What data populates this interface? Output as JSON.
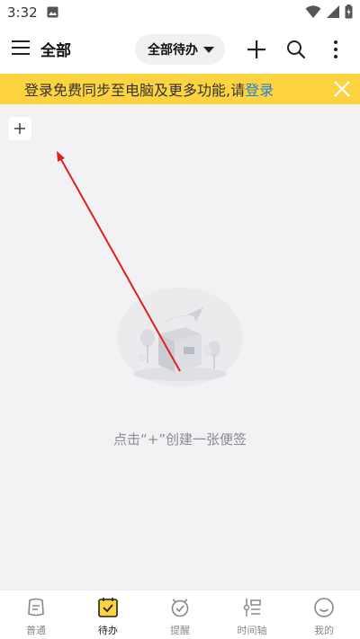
{
  "status": {
    "time": "3:32",
    "icons": [
      "image-icon",
      "wifi-icon",
      "signal-icon",
      "battery-icon"
    ]
  },
  "app_bar": {
    "title": "全部",
    "filter_label": "全部待办",
    "icons": [
      "menu-icon",
      "add-icon",
      "search-icon",
      "more-icon"
    ]
  },
  "banner": {
    "text": "登录免费同步至电脑及更多功能,请",
    "link": "登录",
    "color": "#fdd440",
    "link_color": "#2a7fd8"
  },
  "empty_state": {
    "hint": "点击“+”创建一张便签"
  },
  "bottom_nav": {
    "items": [
      {
        "label": "普通",
        "icon": "note-icon"
      },
      {
        "label": "待办",
        "icon": "todo-icon"
      },
      {
        "label": "提醒",
        "icon": "alarm-icon"
      },
      {
        "label": "时间轴",
        "icon": "timeline-icon"
      },
      {
        "label": "我的",
        "icon": "smile-icon"
      }
    ],
    "active_index": 1,
    "active_color": "#fdd440"
  }
}
